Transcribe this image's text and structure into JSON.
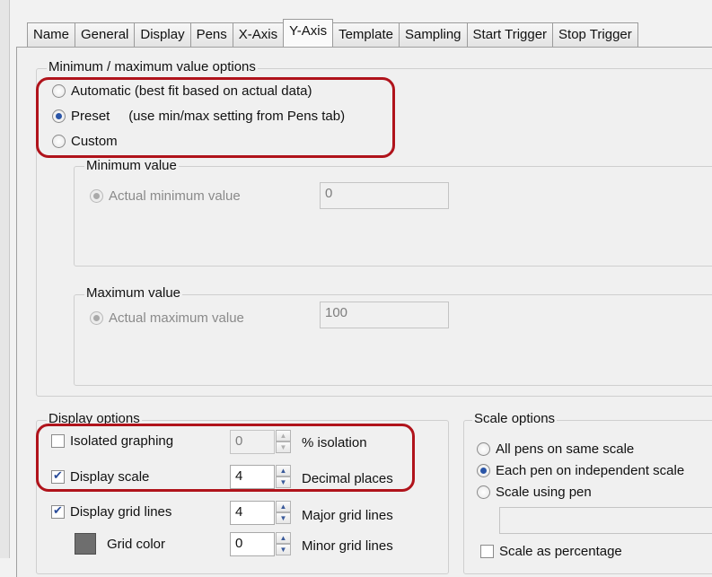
{
  "tabs": [
    "Name",
    "General",
    "Display",
    "Pens",
    "X-Axis",
    "Y-Axis",
    "Template",
    "Sampling",
    "Start Trigger",
    "Stop Trigger"
  ],
  "active_tab": "Y-Axis",
  "minmax": {
    "legend": "Minimum / maximum value options",
    "options": [
      {
        "label": "Automatic (best fit based on actual data)",
        "selected": false
      },
      {
        "label": "Preset     (use min/max setting from Pens tab)",
        "selected": true
      },
      {
        "label": "Custom",
        "selected": false
      }
    ],
    "minimum": {
      "legend": "Minimum value",
      "radio_label": "Actual minimum value",
      "value": "0"
    },
    "maximum": {
      "legend": "Maximum value",
      "radio_label": "Actual maximum value",
      "value": "100"
    }
  },
  "display": {
    "legend": "Display options",
    "isolated": {
      "label": "Isolated graphing",
      "checked": false,
      "value": "0",
      "unit": "% isolation"
    },
    "scale": {
      "label": "Display scale",
      "checked": true,
      "value": "4",
      "unit": "Decimal places"
    },
    "grid": {
      "label": "Display grid lines",
      "checked": true,
      "value": "4",
      "unit": "Major grid lines"
    },
    "grid_color": {
      "label": "Grid color",
      "value": "0",
      "unit": "Minor grid lines",
      "color": "#6e6e6e"
    }
  },
  "scale_options": {
    "legend": "Scale options",
    "options": [
      {
        "label": "All pens on same scale",
        "selected": false
      },
      {
        "label": "Each pen on independent scale",
        "selected": true
      },
      {
        "label": "Scale using pen",
        "selected": false
      }
    ],
    "pen_value": "",
    "percentage": {
      "label": "Scale as percentage",
      "checked": false
    }
  },
  "colors": {
    "callout": "#b0131b",
    "accent": "#2a55a7"
  }
}
